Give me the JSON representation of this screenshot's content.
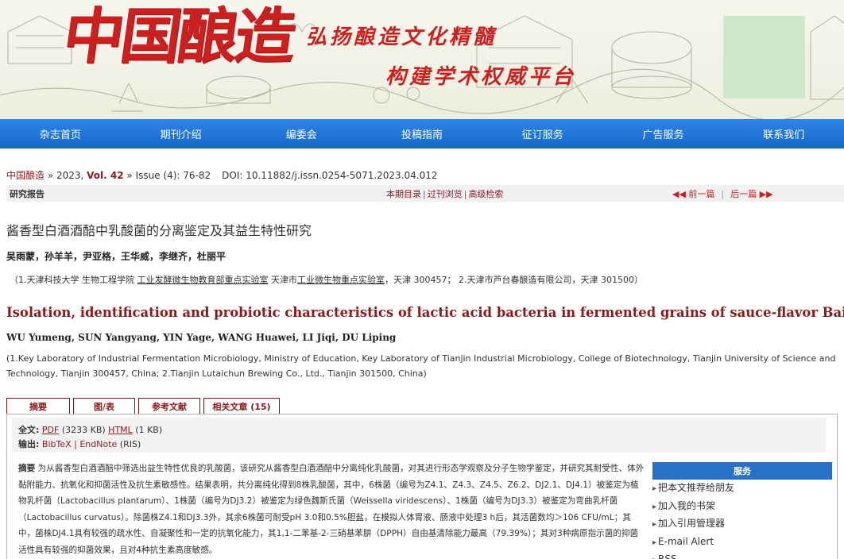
{
  "banner": {
    "logo_text": "中国酿造",
    "slogan_line1": "弘扬酿造文化精髓",
    "slogan_line2": "构建学术权威平台"
  },
  "nav": {
    "items": [
      "杂志首页",
      "期刊介绍",
      "编委会",
      "投稿指南",
      "征订服务",
      "广告服务",
      "联系我们"
    ]
  },
  "breadcrumb": {
    "journal": "中国酿造",
    "sep1": " » 2023, ",
    "volume": "Vol. 42",
    "issue_pages": " » Issue (4): 76-82",
    "doi": "DOI: 10.11882/j.issn.0254-5071.2023.04.012"
  },
  "section": {
    "category": "研究报告",
    "toc": "本期目录",
    "past": "过刊浏览",
    "advanced": "高级检索",
    "prev": "◀◀ 前一篇",
    "next": "后一篇 ▶▶"
  },
  "article": {
    "title_cn": "酱香型白酒酒醅中乳酸菌的分离鉴定及其益生特性研究",
    "authors_cn": "吴雨蒙，孙羊羊，尹亚格，王华威，李继齐，杜丽平",
    "affil_cn_1": "（1.天津科技大学 生物工程学院 ",
    "affil_cn_link": "工业发酵微生物教育部重点实验室",
    "affil_cn_2": " 天津市",
    "affil_cn_link2": "工业微生物重点实验室",
    "affil_cn_3": "，天津 300457； 2.天津市芦台春酿造有限公司，天津 301500）",
    "title_en": "Isolation, identification and probiotic characteristics of lactic acid bacteria in fermented grains of sauce-flavor Baijiu",
    "authors_en": "WU Yumeng, SUN Yangyang, YIN Yage, WANG Huawei, LI Jiqi, DU Liping",
    "affil_en": "(1.Key Laboratory of Industrial Fermentation Microbiology, Ministry of Education, Key Laboratory of Tianjin Industrial Microbiology, College of Biotechnology, Tianjin University of Science and Technology, Tianjin 300457, China; 2.Tianjin Lutaichun Brewing Co., Ltd., Tianjin 301500, China)"
  },
  "tabs": [
    "摘要",
    "图/表",
    "参考文献",
    "相关文章 (15)"
  ],
  "fulltext": {
    "label": "全文:",
    "pdf": "PDF",
    "pdf_size": " (3233 KB)  ",
    "html": "HTML",
    "html_size": " (1 KB)",
    "export_label": "输出:",
    "bibtex": "BibTeX",
    "sep": " | ",
    "endnote": "EndNote",
    "ris": " (RIS)"
  },
  "abstract": {
    "label": "摘要",
    "text": " 为从酱香型白酒酒醅中筛选出益生特性优良的乳酸菌，该研究从酱香型白酒酒醅中分离纯化乳酸菌，对其进行形态学观察及分子生物学鉴定，并研究其耐受性、体外黏附能力、抗氧化和抑菌活性及抗生素敏感性。结果表明，共分离纯化得到8株乳酸菌，其中，6株菌（编号为Z4.1、Z4.3、Z4.5、Z6.2、DJ2.1、DJ4.1）被鉴定为植物乳杆菌（Lactobacillus plantarum）、1株菌（编号为DJ3.2）被鉴定为绿色魏斯氏菌（Weissella viridescens）、1株菌（编号为DJ3.3）被鉴定为弯曲乳杆菌（Lactobacillus curvatus）。除菌株Z4.1和DJ3.3外，其余6株菌可耐受pH 3.0和0.5%胆盐，在模拟人体胃液、肠液中处理3 h后，其活菌数均＞106 CFU/mL；其中，菌株DJ4.1具有较强的疏水性、自凝聚性和一定的抗氧化能力，其1,1-二苯基-2-三硝基苯肼（DPPH）自由基清除能力最高（79.39%）；其对3种病原指示菌的抑菌活性具有较强的抑菌效果，且对4种抗生素高度敏感。"
  },
  "services": {
    "title": "服务",
    "items": [
      "把本文推荐给朋友",
      "加入我的书架",
      "加入引用管理器",
      "E-mail Alert",
      "RSS"
    ]
  }
}
